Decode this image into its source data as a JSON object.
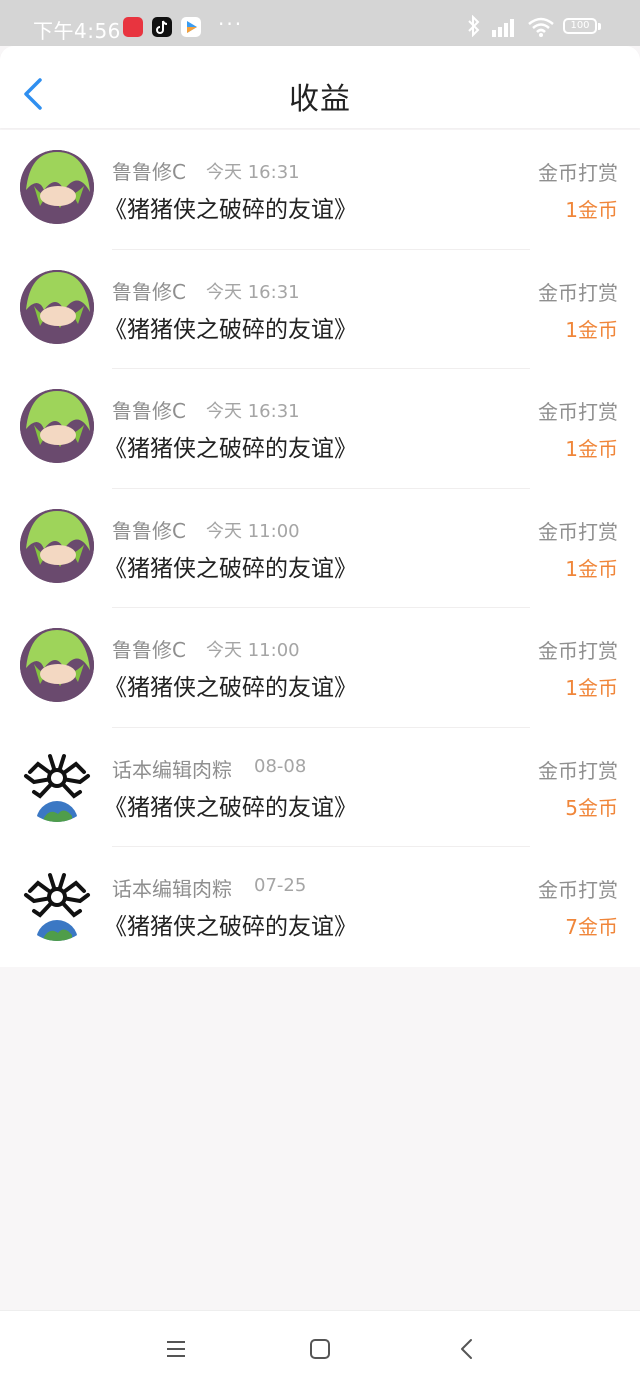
{
  "status_bar": {
    "time": "下午4:56",
    "battery": "100"
  },
  "nav": {
    "title": "收益"
  },
  "items": [
    {
      "user": "鲁鲁修C",
      "time": "今天 16:31",
      "work": "《猪猪侠之破碎的友谊》",
      "type": "金币打赏",
      "amount": "1金币",
      "avatar": "green-hair-avatar"
    },
    {
      "user": "鲁鲁修C",
      "time": "今天 16:31",
      "work": "《猪猪侠之破碎的友谊》",
      "type": "金币打赏",
      "amount": "1金币",
      "avatar": "green-hair-avatar"
    },
    {
      "user": "鲁鲁修C",
      "time": "今天 16:31",
      "work": "《猪猪侠之破碎的友谊》",
      "type": "金币打赏",
      "amount": "1金币",
      "avatar": "green-hair-avatar"
    },
    {
      "user": "鲁鲁修C",
      "time": "今天 11:00",
      "work": "《猪猪侠之破碎的友谊》",
      "type": "金币打赏",
      "amount": "1金币",
      "avatar": "green-hair-avatar"
    },
    {
      "user": "鲁鲁修C",
      "time": "今天 11:00",
      "work": "《猪猪侠之破碎的友谊》",
      "type": "金币打赏",
      "amount": "1金币",
      "avatar": "green-hair-avatar"
    },
    {
      "user": "话本编辑肉粽",
      "time": "08-08",
      "work": "《猪猪侠之破碎的友谊》",
      "type": "金币打赏",
      "amount": "5金币",
      "avatar": "spider-globe-avatar"
    },
    {
      "user": "话本编辑肉粽",
      "time": "07-25",
      "work": "《猪猪侠之破碎的友谊》",
      "type": "金币打赏",
      "amount": "7金币",
      "avatar": "spider-globe-avatar"
    }
  ],
  "colors": {
    "accent": "#2f8ff0",
    "amount": "#f0863a",
    "background": "#f8f6f7"
  }
}
